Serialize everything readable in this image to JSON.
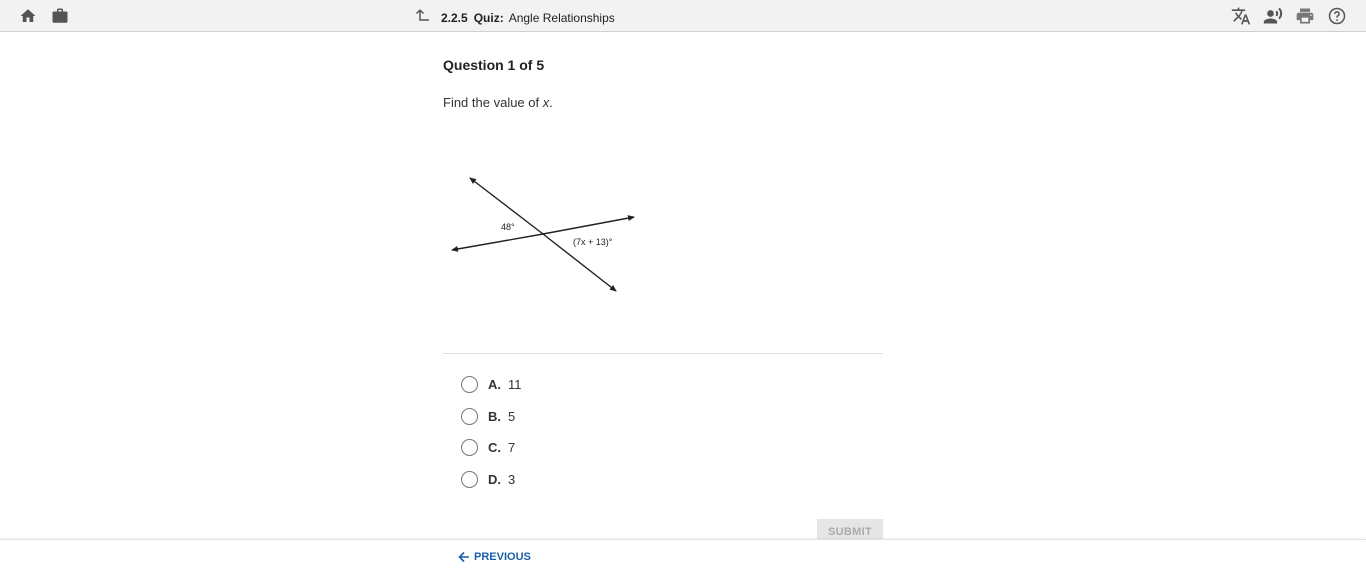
{
  "header": {
    "activity_number": "2.2.5",
    "activity_type": "Quiz:",
    "activity_title": "Angle Relationships",
    "icons": [
      "home-icon",
      "briefcase-icon",
      "back-arrow-icon",
      "translate-icon",
      "text-to-speech-icon",
      "print-icon",
      "help-icon"
    ]
  },
  "question": {
    "heading": "Question 1 of 5",
    "prompt_text": "Find the value of ",
    "prompt_variable": "x",
    "prompt_end": "."
  },
  "diagram": {
    "angle_left_label": "48°",
    "angle_right_label": "(7x + 13)°"
  },
  "choices": [
    {
      "letter": "A.",
      "value": "11"
    },
    {
      "letter": "B.",
      "value": "5"
    },
    {
      "letter": "C.",
      "value": "7"
    },
    {
      "letter": "D.",
      "value": "3"
    }
  ],
  "submit_label": "SUBMIT",
  "nav": {
    "previous_label": "PREVIOUS"
  },
  "colors": {
    "link": "#1a5fa8",
    "topbar": "#f2f2f2",
    "icon": "#555555"
  }
}
